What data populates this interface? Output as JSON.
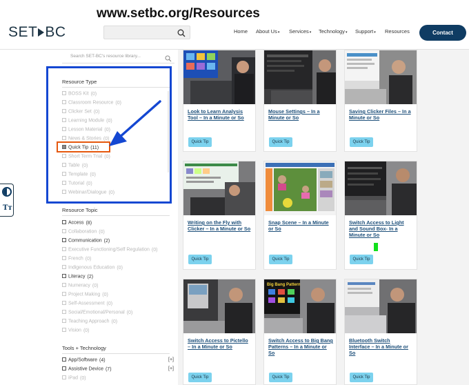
{
  "overlay_caption": "www.setbc.org/Resources",
  "header": {
    "logo_left": "SET",
    "logo_right": "BC",
    "search_placeholder": "",
    "nav": [
      "Home",
      "About Us",
      "Services",
      "Technology",
      "Support",
      "Resources"
    ],
    "nav_caret": "▾",
    "contact_label": "Contact",
    "brand_color": "#0f3c63"
  },
  "side_tools": {
    "text_size_label": "Tт"
  },
  "sidebar": {
    "search_placeholder": "Search SET-BC's resource library...",
    "resource_type": {
      "title": "Resource Type",
      "items": [
        {
          "label": "BOSS Kit",
          "count": "(0)"
        },
        {
          "label": "Classroom Resource",
          "count": "(0)"
        },
        {
          "label": "Clicker Set",
          "count": "(0)"
        },
        {
          "label": "Learning Module",
          "count": "(0)"
        },
        {
          "label": "Lesson Material",
          "count": "(0)"
        },
        {
          "label": "News & Stories",
          "count": "(0)"
        },
        {
          "label": "Quick Tip",
          "count": "(11)"
        },
        {
          "label": "Short Term Trial",
          "count": "(0)"
        },
        {
          "label": "Table",
          "count": "(0)"
        },
        {
          "label": "Template",
          "count": "(0)"
        },
        {
          "label": "Tutorial",
          "count": "(0)"
        },
        {
          "label": "Webinar/Dialogue",
          "count": "(0)"
        }
      ]
    },
    "resource_topic": {
      "title": "Resource Topic",
      "items": [
        {
          "label": "Access",
          "count": "(8)"
        },
        {
          "label": "Collaboration",
          "count": "(0)"
        },
        {
          "label": "Communication",
          "count": "(2)"
        },
        {
          "label": "Executive Functioning/Self Regulation",
          "count": "(0)"
        },
        {
          "label": "French",
          "count": "(0)"
        },
        {
          "label": "Indigenous Education",
          "count": "(0)"
        },
        {
          "label": "Literacy",
          "count": "(2)"
        },
        {
          "label": "Numeracy",
          "count": "(0)"
        },
        {
          "label": "Project Making",
          "count": "(0)"
        },
        {
          "label": "Self-Assessment",
          "count": "(0)"
        },
        {
          "label": "Social/Emotional/Personal",
          "count": "(0)"
        },
        {
          "label": "Teaching Approach",
          "count": "(0)"
        },
        {
          "label": "Vision",
          "count": "(0)"
        }
      ]
    },
    "tools_technology": {
      "title": "Tools + Technology",
      "items": [
        {
          "label": "App/Software",
          "count": "(4)",
          "expand": "[+]"
        },
        {
          "label": "Assistive Device",
          "count": "(7)",
          "expand": "[+]"
        },
        {
          "label": "iPad",
          "count": "(0)"
        }
      ]
    }
  },
  "cards": [
    {
      "title_lines": [
        "Look to Learn Analysis",
        "Tool – In a Minute or So"
      ],
      "tag": "Quick Tip"
    },
    {
      "title_lines": [
        "Mouse Settings – In a",
        "Minute or So"
      ],
      "tag": "Quick Tip"
    },
    {
      "title_lines": [
        "Saving Clicker Files – In a",
        "Minute or So"
      ],
      "tag": "Quick Tip"
    },
    {
      "title_lines": [
        "Writing on the Fly with",
        "Clicker – In a Minute or So"
      ],
      "tag": "Quick Tip"
    },
    {
      "title_lines": [
        "Snap Scene – In a Minute",
        "or So"
      ],
      "tag": "Quick Tip"
    },
    {
      "title_lines": [
        "Switch Access to Light",
        "and Sound Box- In a",
        "Minute or So"
      ],
      "tag": "Quick Tip"
    },
    {
      "title_lines": [
        "Switch Access to Pictello",
        "– In a Minute or So"
      ],
      "tag": "Quick Tip"
    },
    {
      "title_lines": [
        "Switch Access to Big Bang",
        "Patterns – In a Minute or",
        "So"
      ],
      "tag": "Quick Tip"
    },
    {
      "title_lines": [
        "Bluetooth Switch",
        "Interface – In a Minute or",
        "So"
      ],
      "tag": "Quick Tip"
    }
  ],
  "thumb_texts": {
    "big_bang": "Big Bang Patterns"
  },
  "colors": {
    "tag_bg": "#7cd2ee",
    "highlight_blue": "#1447d2",
    "highlight_orange": "#e5570c",
    "link": "#1d4f7a"
  }
}
